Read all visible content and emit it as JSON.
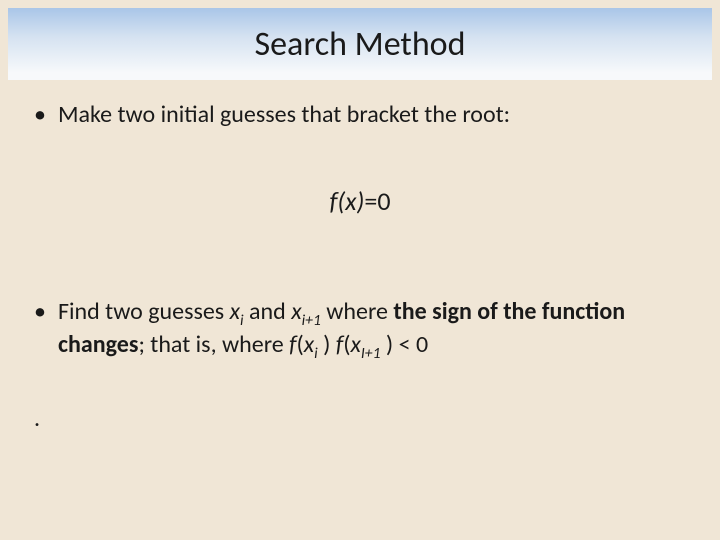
{
  "title": "Search Method",
  "bullets": {
    "b1": "Make two initial guesses that bracket the root:",
    "b2_before": "Find two guesses ",
    "b2_x": "x",
    "b2_sub_i": "i",
    "b2_and": " and ",
    "b2_sub_ip1": "i+1",
    "b2_mid": " where ",
    "b2_bold": "the sign of the function changes",
    "b2_after1": "; that is, where ",
    "b2_f": "f",
    "b2_open": "(",
    "b2_close": " )",
    "b2_space": " ",
    "b2_sub_Ip1": "I+1",
    "b2_lt": " < 0"
  },
  "equation": {
    "fx": "f(x)",
    "eq": "=0"
  },
  "lone_dot": "."
}
